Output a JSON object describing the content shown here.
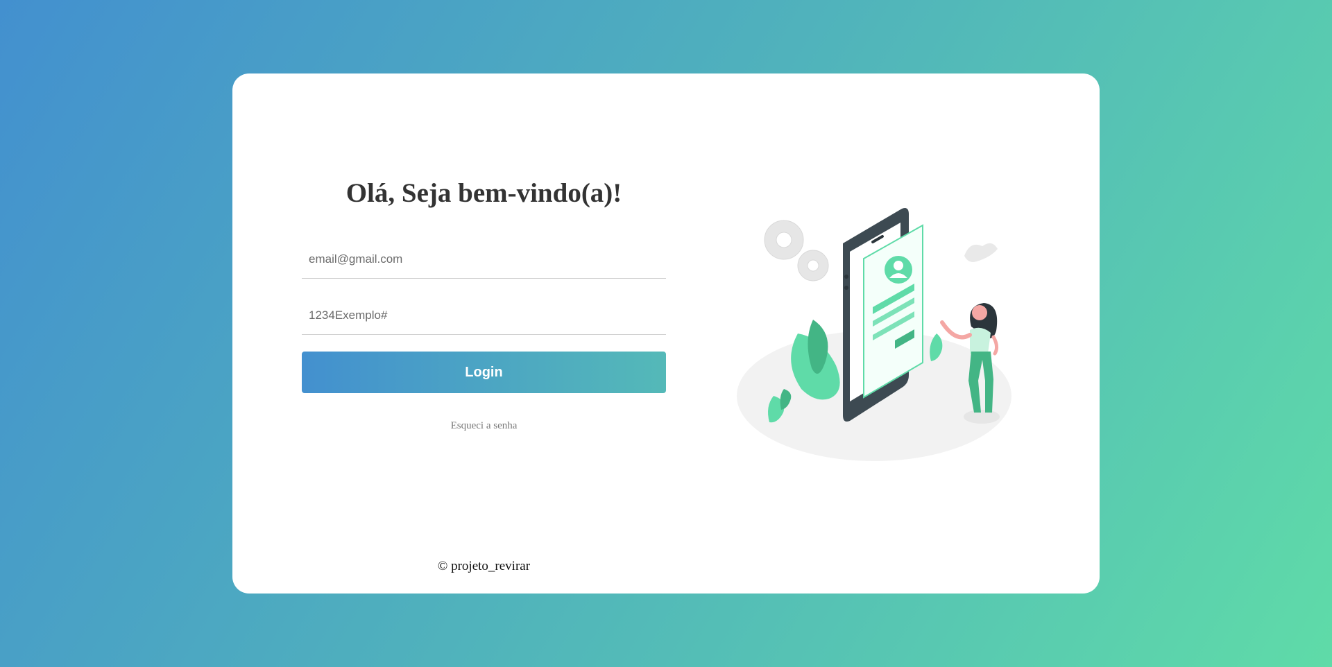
{
  "login": {
    "title": "Olá, Seja bem-vindo(a)!",
    "email_placeholder": "email@gmail.com",
    "password_placeholder": "1234Exemplo#",
    "login_label": "Login",
    "forgot_label": "Esqueci a senha"
  },
  "footer": {
    "copyright": "© projeto_revirar"
  },
  "illustration": {
    "icon": "mobile-login-illustration"
  },
  "colors": {
    "gradient_start": "#4390cf",
    "gradient_end": "#5fdba8",
    "accent_green": "#5fdba8",
    "phone_dark": "#3d4a52"
  }
}
